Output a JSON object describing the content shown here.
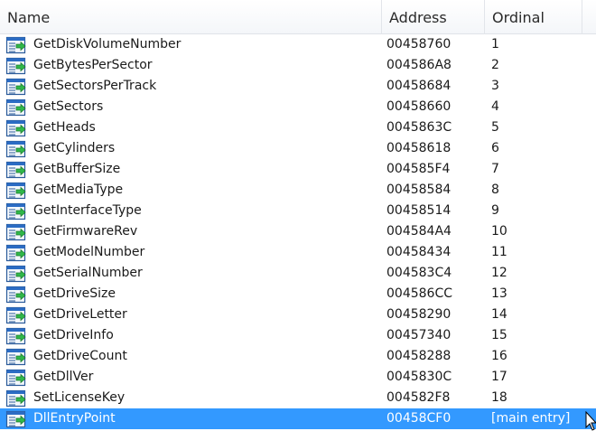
{
  "columns": {
    "name": "Name",
    "address": "Address",
    "ordinal": "Ordinal"
  },
  "functions": [
    {
      "name": "GetDiskVolumeNumber",
      "address": "00458760",
      "ordinal": "1"
    },
    {
      "name": "GetBytesPerSector",
      "address": "004586A8",
      "ordinal": "2"
    },
    {
      "name": "GetSectorsPerTrack",
      "address": "00458684",
      "ordinal": "3"
    },
    {
      "name": "GetSectors",
      "address": "00458660",
      "ordinal": "4"
    },
    {
      "name": "GetHeads",
      "address": "0045863C",
      "ordinal": "5"
    },
    {
      "name": "GetCylinders",
      "address": "00458618",
      "ordinal": "6"
    },
    {
      "name": "GetBufferSize",
      "address": "004585F4",
      "ordinal": "7"
    },
    {
      "name": "GetMediaType",
      "address": "00458584",
      "ordinal": "8"
    },
    {
      "name": "GetInterfaceType",
      "address": "00458514",
      "ordinal": "9"
    },
    {
      "name": "GetFirmwareRev",
      "address": "004584A4",
      "ordinal": "10"
    },
    {
      "name": "GetModelNumber",
      "address": "00458434",
      "ordinal": "11"
    },
    {
      "name": "GetSerialNumber",
      "address": "004583C4",
      "ordinal": "12"
    },
    {
      "name": "GetDriveSize",
      "address": "004586CC",
      "ordinal": "13"
    },
    {
      "name": "GetDriveLetter",
      "address": "00458290",
      "ordinal": "14"
    },
    {
      "name": "GetDriveInfo",
      "address": "00457340",
      "ordinal": "15"
    },
    {
      "name": "GetDriveCount",
      "address": "00458288",
      "ordinal": "16"
    },
    {
      "name": "GetDllVer",
      "address": "0045830C",
      "ordinal": "17"
    },
    {
      "name": "SetLicenseKey",
      "address": "004582F8",
      "ordinal": "18"
    },
    {
      "name": "DllEntryPoint",
      "address": "00458CF0",
      "ordinal": "[main entry]",
      "selected": true
    }
  ],
  "icon": "exported-function-icon",
  "colors": {
    "selection": "#3399ff",
    "selection_text": "#ffffff"
  }
}
